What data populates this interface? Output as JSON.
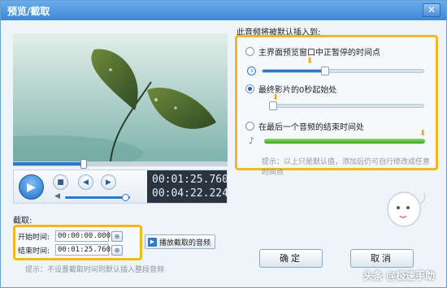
{
  "window": {
    "title": "预览/截取",
    "close_glyph": "✕"
  },
  "player": {
    "play_glyph": "▶",
    "stop_glyph": "■",
    "prev_glyph": "◀",
    "next_glyph": "▶",
    "volume_glyph": "◀",
    "current_time": "00:01:25.760",
    "total_time": "00:04:22.224",
    "seek_progress": 0.33,
    "volume_level": 0.93,
    "expand_glyph": "⌄"
  },
  "insert_panel": {
    "heading": "此音频将被默认插入到:",
    "options": [
      {
        "label": "主界面预览窗口中正暂停的时间点",
        "checked": false,
        "marker_pos": 0.39
      },
      {
        "label": "最终影片的0秒起始处",
        "checked": true,
        "marker_pos": 0.0
      },
      {
        "label": "在最后一个音频的结束时间处",
        "checked": false,
        "marker_pos": 1.0
      }
    ],
    "option1_progress": 0.39,
    "pause_glyph": "॥",
    "music_glyph": "♪",
    "marker_glyph": "⬇",
    "hint": "提示：以上只是默认值，添加后仍可自行修改成任意时间点"
  },
  "cut": {
    "heading": "截取:",
    "start_label": "开始时间:",
    "start_value": "00:00:00.000",
    "end_label": "结束时间:",
    "end_value": "00:01:25.760",
    "pick_glyph": "⊕",
    "play_cut_label": "播放截取的音频",
    "play_cut_glyph": "▶",
    "hint": "提示：不设置截取时间则默认插入整段音频"
  },
  "buttons": {
    "ok": "确定",
    "cancel": "取消"
  },
  "watermark": "头条 @极速手助",
  "colors": {
    "accent": "#2d78c8",
    "highlight": "#f3b820",
    "titlebar": "#3d87d6"
  }
}
